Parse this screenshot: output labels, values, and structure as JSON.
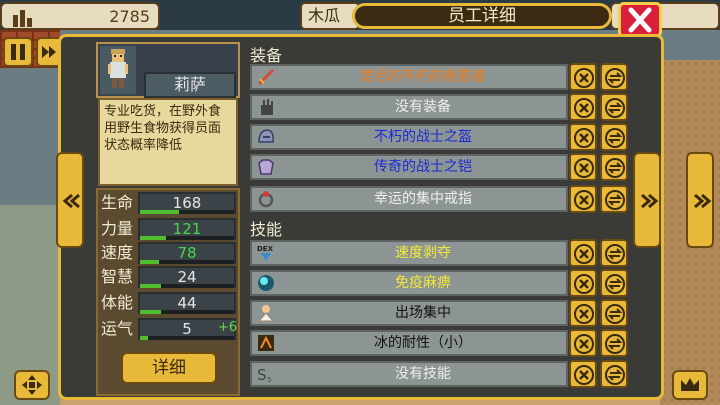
{
  "top": {
    "money": "2785",
    "place_tab": "木瓜",
    "title": "员工详细"
  },
  "character": {
    "name": "莉萨",
    "description": "专业吃货，在野外食用野生食物获得员面状态概率降低",
    "detail_label": "详细"
  },
  "stats": [
    {
      "label": "生命",
      "value": "168",
      "value_color": "#e6e6e6",
      "fill": 0.42,
      "bonus": ""
    },
    {
      "label": "力量",
      "value": "121",
      "value_color": "#46d84a",
      "fill": 0.28,
      "bonus": ""
    },
    {
      "label": "速度",
      "value": "78",
      "value_color": "#46d84a",
      "fill": 0.2,
      "bonus": ""
    },
    {
      "label": "智慧",
      "value": "24",
      "value_color": "#e6e6e6",
      "fill": 0.22,
      "bonus": ""
    },
    {
      "label": "体能",
      "value": "44",
      "value_color": "#e6e6e6",
      "fill": 0.22,
      "bonus": ""
    },
    {
      "label": "运气",
      "value": "5",
      "value_color": "#e6e6e6",
      "fill": 0.08,
      "bonus": "+6"
    }
  ],
  "equipment_title": "装备",
  "equipment": [
    {
      "text": "焚尽的不朽的断筋者",
      "color": "#f07d1c",
      "icon": "sword-icon"
    },
    {
      "text": "没有装备",
      "color": "#efefef",
      "icon": "glove-icon"
    },
    {
      "text": "不朽的战士之盔",
      "color": "#1c2ad8",
      "icon": "helmet-icon"
    },
    {
      "text": "传奇的战士之铠",
      "color": "#1c2ad8",
      "icon": "armor-icon"
    },
    {
      "text": "幸运的集中戒指",
      "color": "#efefef",
      "icon": "ring-icon"
    }
  ],
  "skills_title": "技能",
  "skills": [
    {
      "text": "速度剥夺",
      "color": "#f3e83a",
      "icon": "dex-icon",
      "icon_text": "DEX"
    },
    {
      "text": "免疫麻痹",
      "color": "#f3e83a",
      "icon": "orb-icon",
      "icon_text": ""
    },
    {
      "text": "出场集中",
      "color": "#111111",
      "icon": "focus-icon",
      "icon_text": ""
    },
    {
      "text": "冰的耐性（小）",
      "color": "#111111",
      "icon": "ice-resist-icon",
      "icon_text": ""
    },
    {
      "text": "没有技能",
      "color": "#efefef",
      "icon": "skill-slot-icon",
      "icon_text": "S5"
    }
  ],
  "colors": {
    "gold": "#e9b93a",
    "panel": "#3a3b36",
    "close": "#d8203a"
  }
}
